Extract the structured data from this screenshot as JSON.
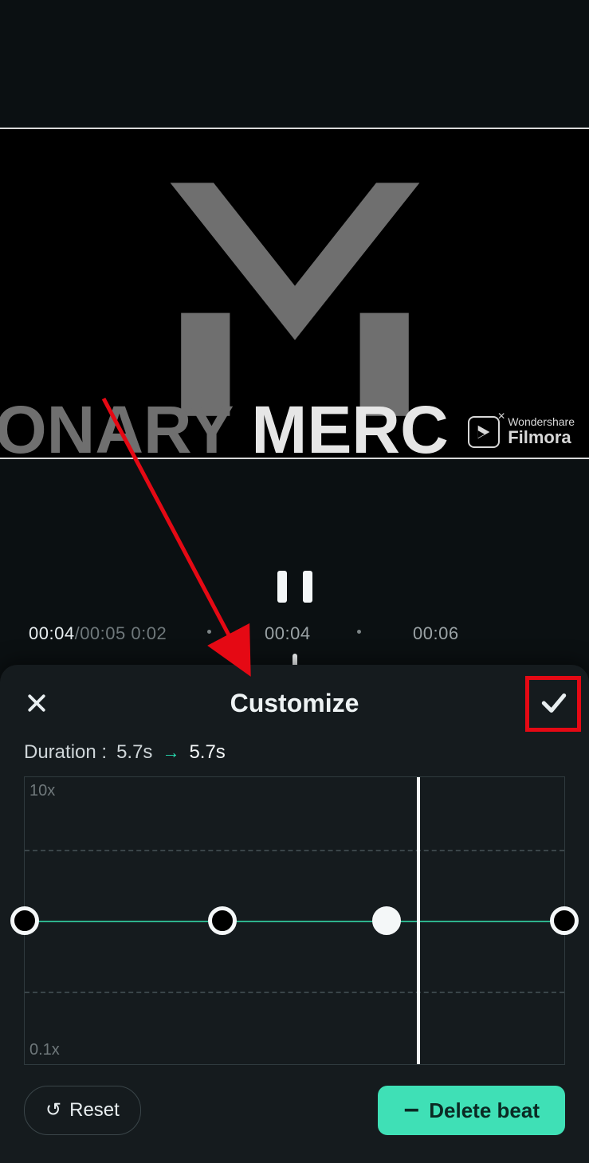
{
  "watermark": {
    "line1": "Wondershare",
    "line2": "Filmora"
  },
  "preview_text": {
    "dark_part": "IONARY",
    "light_part": " MERC"
  },
  "playback": {
    "current": "00:04",
    "total": "00:05",
    "extra": "0:02",
    "tick_mid": "00:04",
    "tick_right": "00:06"
  },
  "panel": {
    "title": "Customize",
    "duration_label": "Duration :",
    "duration_from": "5.7s",
    "duration_to": "5.7s"
  },
  "graph": {
    "y_top": "10x",
    "y_bot": "0.1x",
    "markers_pct": [
      0,
      36.6,
      67.0,
      100
    ],
    "active_marker_index": 2,
    "playhead_pct": 73.0,
    "dash_lines_pct": [
      25.4,
      74.6
    ]
  },
  "buttons": {
    "reset": "Reset",
    "delete_beat": "Delete beat"
  }
}
